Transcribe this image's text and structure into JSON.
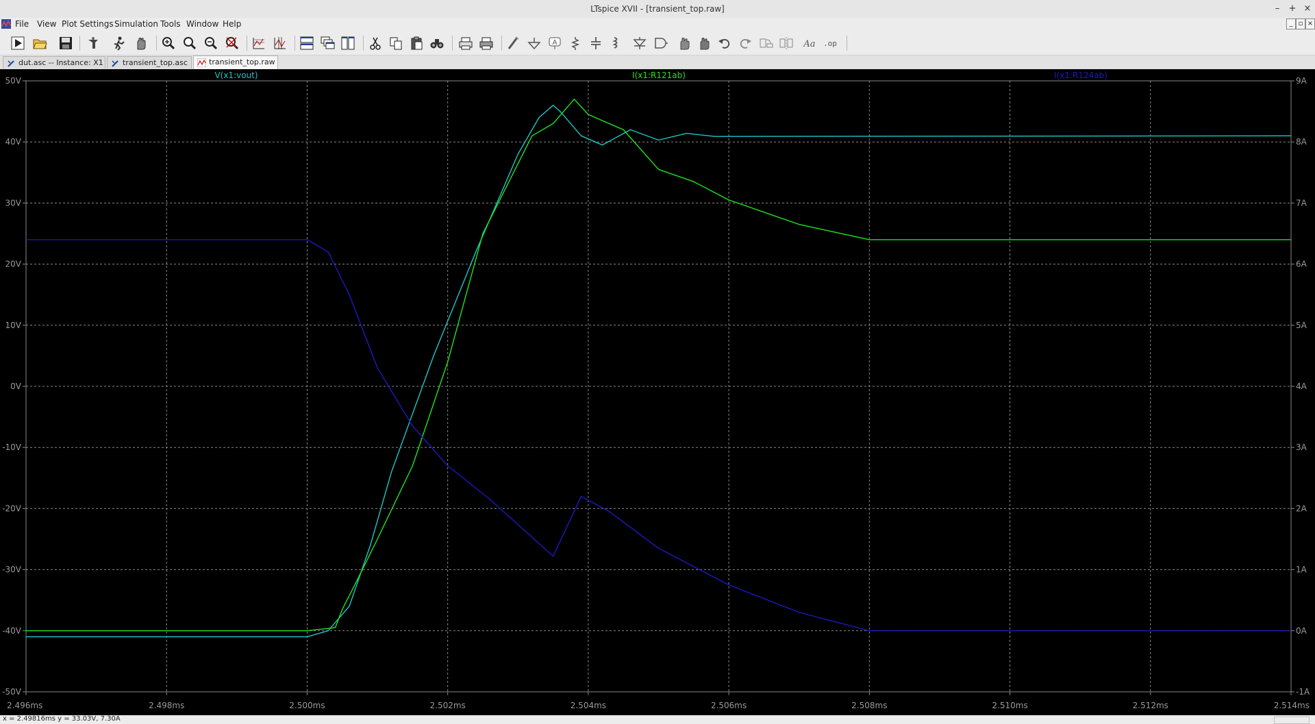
{
  "window": {
    "title": "LTspice XVII - [transient_top.raw]",
    "minimize": "–",
    "maximize": "+",
    "close": "×"
  },
  "menu": [
    "File",
    "View",
    "Plot Settings",
    "Simulation",
    "Tools",
    "Window",
    "Help"
  ],
  "tabs": [
    {
      "label": "dut.asc -- Instance: X1",
      "icon": "schematic-icon"
    },
    {
      "label": "transient_top.asc",
      "icon": "schematic-icon"
    },
    {
      "label": "transient_top.raw",
      "icon": "waveform-icon",
      "active": true
    }
  ],
  "toolbar": [
    "run-icon",
    "open-icon",
    "save-icon",
    "control-panel-icon",
    "halt-icon",
    "pan-icon",
    "zoom-in-icon",
    "zoom-area-icon",
    "zoom-out-icon",
    "zoom-fit-icon",
    "autorange-icon",
    "pick-visible-icon",
    "tile-horizontal-icon",
    "cascade-icon",
    "tile-vertical-icon",
    "cut-icon",
    "copy-icon",
    "paste-icon",
    "find-icon",
    "print-setup-icon",
    "print-icon",
    "wire-icon",
    "ground-icon",
    "label-icon",
    "resistor-icon",
    "capacitor-icon",
    "inductor-icon",
    "diode-icon",
    "component-icon",
    "move-icon",
    "drag-icon",
    "undo-icon",
    "redo-icon",
    "rotate-icon",
    "mirror-icon",
    "text-icon",
    "spice-directive-icon"
  ],
  "colors": {
    "vout": "#1ec6c6",
    "r121": "#1ee61e",
    "r124": "#1a1ac4",
    "grid": "#8a8a8a",
    "axis_text": "#9a9a9a",
    "background": "#000000"
  },
  "chart_data": {
    "type": "line",
    "x_unit": "ms",
    "xlim": [
      2.496,
      2.514
    ],
    "x_ticks": [
      "2.496ms",
      "2.498ms",
      "2.500ms",
      "2.502ms",
      "2.504ms",
      "2.506ms",
      "2.508ms",
      "2.510ms",
      "2.512ms",
      "2.514ms"
    ],
    "left_axis": {
      "unit": "V",
      "ylim": [
        -50,
        50
      ],
      "ticks": [
        "50V",
        "40V",
        "30V",
        "20V",
        "10V",
        "0V",
        "-10V",
        "-20V",
        "-30V",
        "-40V",
        "-50V"
      ]
    },
    "right_axis": {
      "unit": "A",
      "ylim": [
        -1,
        9
      ],
      "ticks": [
        "9A",
        "8A",
        "7A",
        "6A",
        "5A",
        "4A",
        "3A",
        "2A",
        "1A",
        "0A",
        "-1A"
      ]
    },
    "grid": true,
    "series": [
      {
        "name": "V(x1:vout)",
        "axis": "left",
        "color": "#1ec6c6",
        "x": [
          2.496,
          2.5,
          2.5003,
          2.5006,
          2.5009,
          2.5012,
          2.5018,
          2.5024,
          2.503,
          2.5033,
          2.5035,
          2.5036,
          2.5039,
          2.5042,
          2.5046,
          2.505,
          2.5054,
          2.5058,
          2.514
        ],
        "y": [
          -41,
          -41,
          -40,
          -36,
          -26,
          -14,
          5,
          22,
          38,
          44,
          46,
          45,
          41,
          39.5,
          42,
          40.3,
          41.4,
          40.9,
          41
        ]
      },
      {
        "name": "I(x1:R121ab)",
        "axis": "right",
        "color": "#1ee61e",
        "x": [
          2.496,
          2.5,
          2.5004,
          2.5005,
          2.5007,
          2.501,
          2.5015,
          2.502,
          2.5025,
          2.5032,
          2.5035,
          2.5038,
          2.504,
          2.5045,
          2.505,
          2.5055,
          2.506,
          2.507,
          2.508,
          2.514
        ],
        "y": [
          0,
          0,
          0.05,
          0.35,
          0.8,
          1.5,
          2.7,
          4.4,
          6.5,
          8.1,
          8.3,
          8.7,
          8.45,
          8.2,
          7.55,
          7.35,
          7.05,
          6.65,
          6.4,
          6.4
        ]
      },
      {
        "name": "I(x1:R124ab)",
        "axis": "right",
        "color": "#1a1ac4",
        "x": [
          2.496,
          2.5,
          2.5003,
          2.5006,
          2.501,
          2.5015,
          2.502,
          2.5026,
          2.5035,
          2.5039,
          2.5043,
          2.505,
          2.506,
          2.507,
          2.508,
          2.514
        ],
        "y": [
          6.4,
          6.4,
          6.2,
          5.5,
          4.3,
          3.35,
          2.7,
          2.15,
          1.22,
          2.2,
          1.95,
          1.35,
          0.75,
          0.3,
          0,
          0
        ]
      }
    ]
  },
  "status": {
    "cursor_readout": "x = 2.49816ms    y = 33.03V, 7.30A"
  }
}
